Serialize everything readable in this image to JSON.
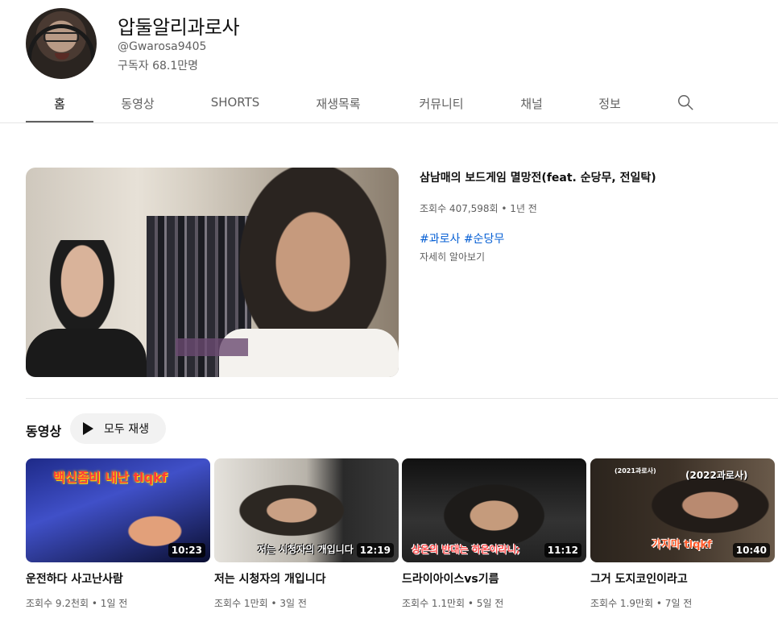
{
  "channel": {
    "name": "압둘알리과로사",
    "handle": "@Gwarosa9405",
    "subscribers": "구독자 68.1만명"
  },
  "tabs": [
    {
      "label": "홈",
      "active": true
    },
    {
      "label": "동영상"
    },
    {
      "label": "SHORTS"
    },
    {
      "label": "재생목록"
    },
    {
      "label": "커뮤니티"
    },
    {
      "label": "채널"
    },
    {
      "label": "정보"
    }
  ],
  "featured": {
    "title": "삼남매의 보드게임 멸망전(feat. 순당무, 전일탁)",
    "meta": "조회수 407,598회 • 1년 전",
    "hashtags": [
      "#과로사",
      "#순당무"
    ],
    "learn_more": "자세히 알아보기"
  },
  "videos_section": {
    "title": "동영상",
    "play_all": "모두 재생"
  },
  "videos": [
    {
      "title": "운전하다 사고난사람",
      "meta": "조회수 9.2천회 • 1일 전",
      "duration": "10:23",
      "overlay": "백신좀비 내난 tlqkf"
    },
    {
      "title": "저는 시청자의 개입니다",
      "meta": "조회수 1만회 • 3일 전",
      "duration": "12:19",
      "overlay": "저는 시청자의 개입니다"
    },
    {
      "title": "드라이아이스vs기름",
      "meta": "조회수 1.1만회 • 5일 전",
      "duration": "11:12",
      "overlay": "상온의 반대는 하온이라니;"
    },
    {
      "title": "그거 도지코인이라고",
      "meta": "조회수 1.9만회 • 7일 전",
      "duration": "10:40",
      "overlay": "가지마 tlqkf",
      "overlay_top_left": "(2021과로사)",
      "overlay_top_right": "(2022과로사)"
    }
  ],
  "colors": {
    "link": "#065fd4",
    "secondary": "#606060",
    "divider": "#e5e5e5"
  }
}
